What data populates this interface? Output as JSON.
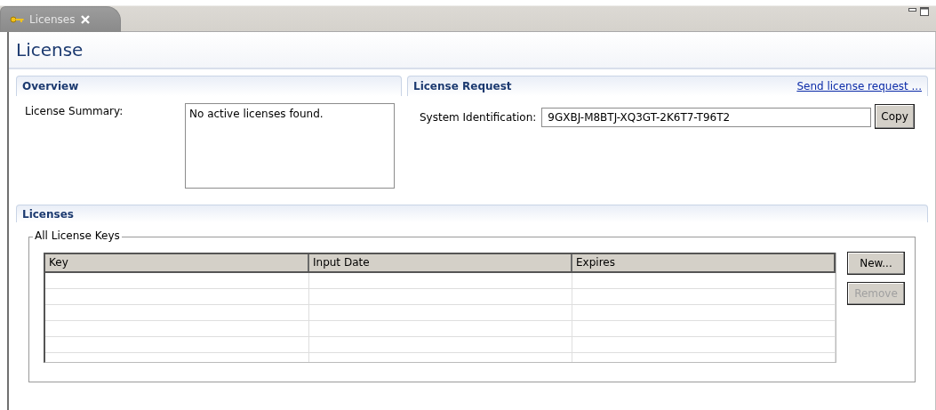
{
  "tabs": [
    {
      "label": "Licenses",
      "selected": true
    }
  ],
  "title": "License",
  "overview": {
    "heading": "Overview",
    "summary_label": "License Summary:",
    "summary_value": "No active licenses found."
  },
  "license_request": {
    "heading": "License Request",
    "link": "Send license request ...",
    "id_label": "System Identification:",
    "id_value": "9GXBJ-M8BTJ-XQ3GT-2K6T7-T96T2",
    "copy_button": "Copy"
  },
  "licenses": {
    "heading": "Licenses",
    "group_label": "All License Keys",
    "columns": [
      "Key",
      "Input Date",
      "Expires"
    ],
    "buttons": [
      {
        "label": "New...",
        "disabled": false
      },
      {
        "label": "Remove",
        "disabled": true
      }
    ]
  }
}
